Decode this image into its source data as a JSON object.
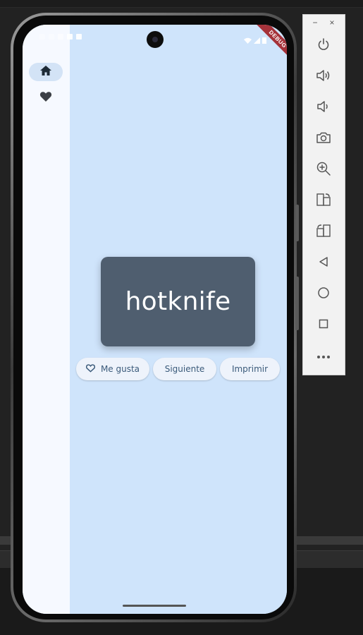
{
  "app": {
    "word": "hotknife",
    "debug_banner": "DEBUG"
  },
  "actions": {
    "like_label": "Me gusta",
    "next_label": "Siguiente",
    "print_label": "Imprimir"
  },
  "rail": {
    "items": [
      {
        "icon": "home-icon",
        "selected": true
      },
      {
        "icon": "heart-icon",
        "selected": false
      }
    ]
  },
  "emulator": {
    "window_controls": [
      "−",
      "×"
    ],
    "buttons": [
      "power-icon",
      "volume-up-icon",
      "volume-down-icon",
      "camera-icon",
      "zoom-icon",
      "rotate-left-icon",
      "rotate-right-icon",
      "back-icon",
      "home-icon",
      "overview-icon",
      "more-icon"
    ]
  },
  "colors": {
    "content_bg": "#cfe4fb",
    "rail_bg": "#f6f9ff",
    "card_bg": "#4f5e6f",
    "pill_bg": "#eef3fb",
    "accent_text": "#3a5a7a",
    "debug": "#a5323a"
  }
}
